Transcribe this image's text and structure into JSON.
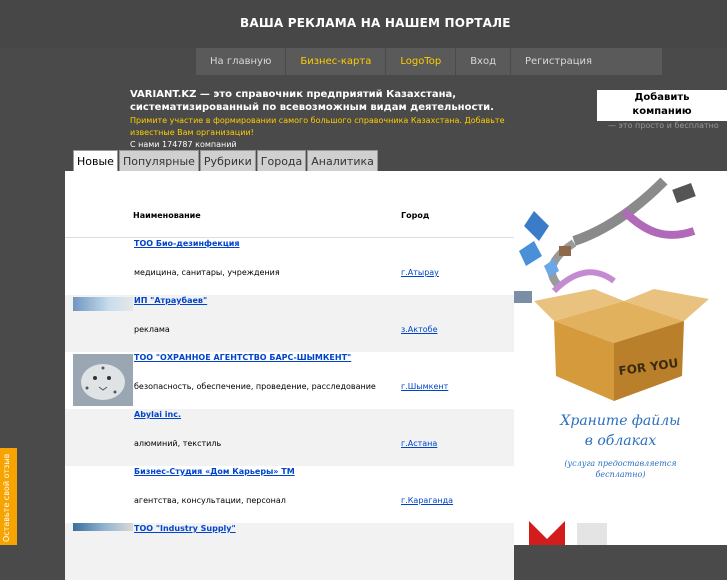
{
  "banner": {
    "text": "ВАША РЕКЛАМА НА НАШЕМ ПОРТАЛЕ"
  },
  "nav": {
    "items": [
      "На главную",
      "Бизнес-карта",
      "LogoTop",
      "Вход",
      "Регистрация"
    ]
  },
  "intro": {
    "title_line1": "VARIANT.KZ — это справочник предприятий Казахстана,",
    "title_line2": "систематизированный по всевозможным видам деятельности.",
    "sub_line1": "Примите участие в формировании самого большого справочника Казахстана. Добавьте",
    "sub_line2": "известные Вам организации!",
    "count": "С нами 174787 компаний"
  },
  "add_company": {
    "line1": "Добавить",
    "line2": "компанию",
    "note": "— это просто и бесплатно"
  },
  "tabs": [
    "Новые",
    "Популярные",
    "Рубрики",
    "Города",
    "Аналитика"
  ],
  "table": {
    "header_name": "Наименование",
    "header_city": "Город",
    "rows": [
      {
        "name": "ТОО Био-дезинфекция",
        "category": "медицина, санитары, учреждения",
        "city": "г.Атырау"
      },
      {
        "name": "ИП \"Атраубаев\"",
        "category": "реклама",
        "city": "з.Актобе"
      },
      {
        "name": "ТОО \"ОХРАННОЕ АГЕНТСТВО БАРС-ШЫМКЕНТ\"",
        "category": "безопасность, обеспечение, проведение, расследование",
        "city": "г.Шымкент"
      },
      {
        "name": "Abylai inc.",
        "category": "алюминий, текстиль",
        "city": "г.Астана"
      },
      {
        "name": "Бизнес-Студия «Дом Карьеры» ТМ",
        "category": "агентства, консультации, персонал",
        "city": "г.Караганда"
      },
      {
        "name": "ТОО \"Industry Supply\"",
        "category": "",
        "city": ""
      }
    ]
  },
  "ad": {
    "box_text": "FOR YOU",
    "title_line1": "Храните файлы",
    "title_line2": "в облаках",
    "sub_line1": "(услуга предоставляется",
    "sub_line2": "бесплатно)"
  },
  "feedback": {
    "label": "Оставьте свой отзыв"
  }
}
